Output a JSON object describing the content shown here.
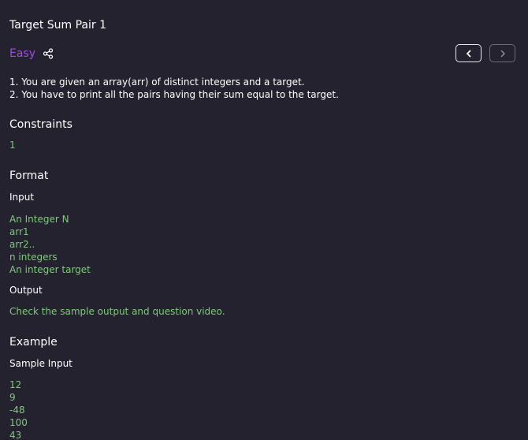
{
  "problem": {
    "title": "Target Sum Pair 1",
    "difficulty": "Easy",
    "description": [
      "1. You are given an array(arr) of distinct integers and a target.",
      "2. You have to print all the pairs having their sum equal to the target."
    ]
  },
  "nav": {
    "prev_icon": "chevron-left-icon",
    "next_icon": "chevron-right-icon"
  },
  "constraints": {
    "heading": "Constraints",
    "value": "1"
  },
  "format": {
    "heading": "Format",
    "input_label": "Input",
    "input_lines": [
      "An Integer N",
      "arr1",
      "arr2..",
      "n integers",
      "An integer target"
    ],
    "output_label": "Output",
    "output_text": "Check the sample output and question video."
  },
  "example": {
    "heading": "Example",
    "sample_input_label": "Sample Input",
    "sample_input_lines": [
      "12",
      "9",
      "-48",
      "100",
      "43"
    ]
  },
  "colors": {
    "background": "#25222f",
    "difficulty": "#9d4fe0",
    "green_text": "#7ec97a"
  }
}
